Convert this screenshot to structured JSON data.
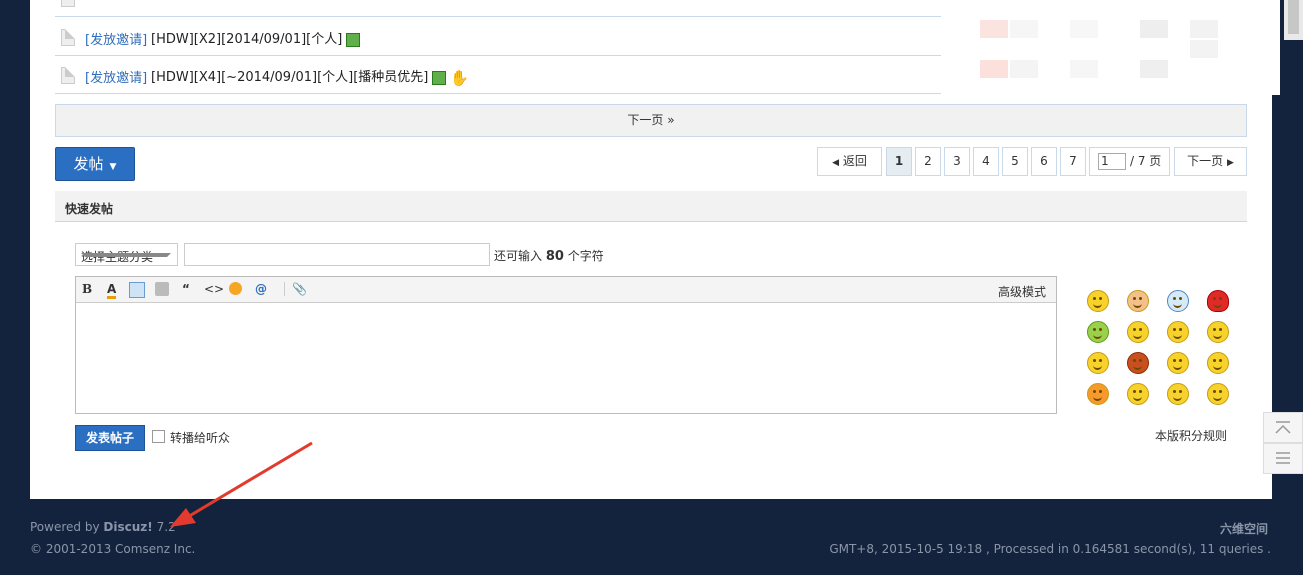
{
  "thread_list": {
    "rows": [
      {
        "tag": "[发放邀请]",
        "title": "[HDW][X2][2014/09/01][个人]",
        "attachment_icon": "image-attachment-icon",
        "extra_icon": null
      },
      {
        "tag": "[发放邀请]",
        "title": "[HDW][X4][~2014/09/01][个人][播种员优先]",
        "attachment_icon": "image-attachment-icon",
        "extra_icon": "thumbs-up-icon"
      }
    ]
  },
  "next_bar": {
    "label": "下一页 »"
  },
  "post_button": {
    "label": "发帖"
  },
  "pagination": {
    "back_label": "返回",
    "pages": [
      "1",
      "2",
      "3",
      "4",
      "5",
      "6",
      "7"
    ],
    "current": "1",
    "input_value": "1",
    "total_label": "/ 7 页",
    "next_label": "下一页"
  },
  "quick_post": {
    "header": "快速发帖",
    "category_select": "选择主题分类",
    "remaining_prefix": "还可输入",
    "remaining_count": "80",
    "remaining_suffix": "个字符",
    "toolbar": {
      "bold": "B",
      "font_color": "A",
      "quote": "“",
      "code": "<>",
      "at": "@",
      "advanced_mode": "高级模式"
    },
    "submit_label": "发表帖子",
    "broadcast_label": "转播给听众",
    "rules_link": "本版积分规则"
  },
  "footer": {
    "powered_prefix": "Powered by",
    "powered_brand": "Discuz!",
    "powered_version": "7.2",
    "copyright": "© 2001-2013 Comsenz Inc.",
    "site_name": "六维空间",
    "stats": "GMT+8, 2015-10-5 19:18 , Processed in 0.164581 second(s), 11 queries ."
  },
  "colors": {
    "page_bg": "#13223d",
    "accent_blue": "#2b6fc2",
    "link_blue": "#2f6ebd",
    "annotation_red": "#e23b2e"
  }
}
